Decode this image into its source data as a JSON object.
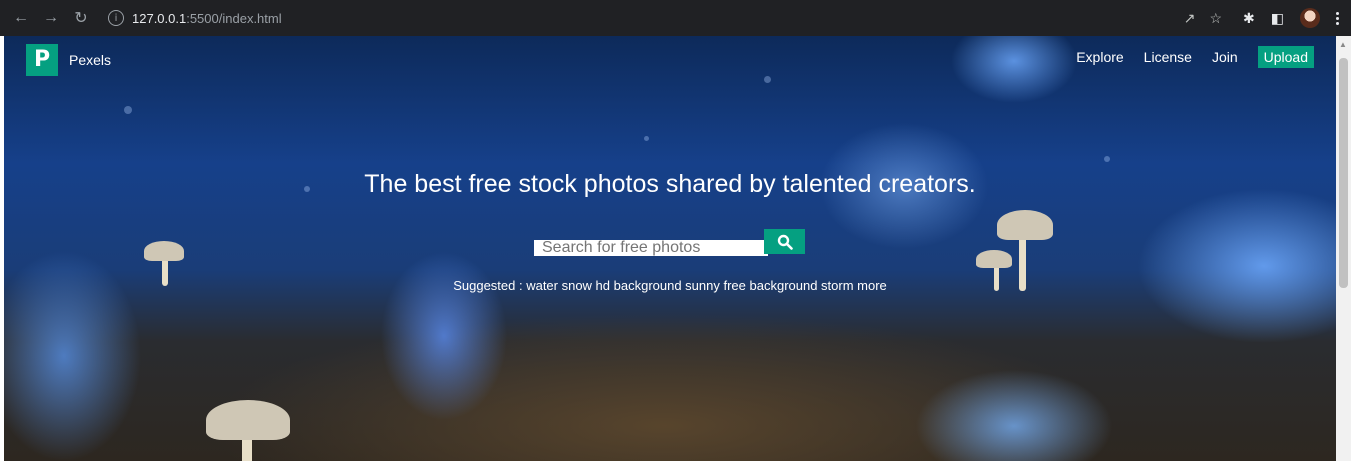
{
  "browser": {
    "url_host": "127.0.0.1",
    "url_rest": ":5500/index.html",
    "icons": [
      "back-icon",
      "forward-icon",
      "reload-icon",
      "info-icon",
      "share-icon",
      "star-icon",
      "extensions-icon",
      "sidepanel-icon",
      "profile-avatar",
      "menu-icon"
    ]
  },
  "header": {
    "logo_letter": "P",
    "brand": "Pexels",
    "nav": [
      "Explore",
      "License",
      "Join"
    ],
    "upload": "Upload"
  },
  "hero": {
    "headline": "The best free stock photos shared by talented creators.",
    "search_placeholder": "Search for free photos",
    "suggested": "Suggested : water snow hd background sunny free background storm more"
  },
  "colors": {
    "accent": "#05a081",
    "chrome_bg": "#202124"
  }
}
